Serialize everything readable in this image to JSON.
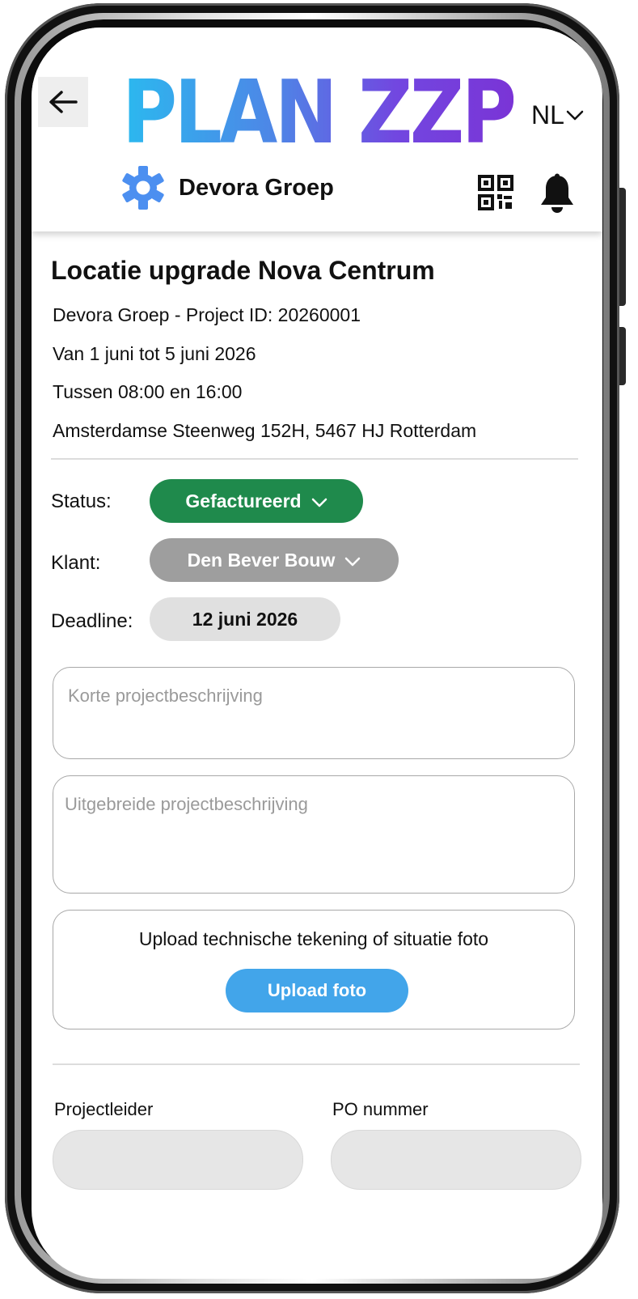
{
  "header": {
    "back_label": "",
    "logo_text": "PLAN ZZP",
    "language": "NL",
    "org_name": "Devora Groep"
  },
  "project": {
    "title": "Locatie upgrade Nova Centrum",
    "id_line": "Devora Groep - Project ID: 20260001",
    "date_line": "Van 1 juni tot 5 juni 2026",
    "time_line": "Tussen 08:00 en 16:00",
    "address_line": "Amsterdamse Steenweg 152H, 5467 HJ Rotterdam"
  },
  "fields": {
    "status_label": "Status:",
    "status_value": "Gefactureerd",
    "client_label": "Klant:",
    "client_value": "Den Bever Bouw",
    "deadline_label": "Deadline:",
    "deadline_value": "12 juni 2026"
  },
  "inputs": {
    "short_description_placeholder": "Korte projectbeschrijving",
    "long_description_placeholder": "Uitgebreide projectbeschrijving"
  },
  "upload": {
    "prompt": "Upload technische tekening of situatie foto",
    "button_label": "Upload foto"
  },
  "bottom": {
    "project_lead_label": "Projectleider",
    "po_number_label": "PO nummer",
    "project_lead_value": "",
    "po_number_value": ""
  },
  "colors": {
    "status_green": "#1f8a4c",
    "client_grey": "#9e9e9e",
    "deadline_grey": "#e0e0e0",
    "upload_blue": "#42a5ea",
    "gear_blue": "#4c8ff0"
  },
  "icons": [
    "back-arrow-icon",
    "gear-icon",
    "qr-code-icon",
    "bell-icon",
    "chevron-down-icon"
  ]
}
